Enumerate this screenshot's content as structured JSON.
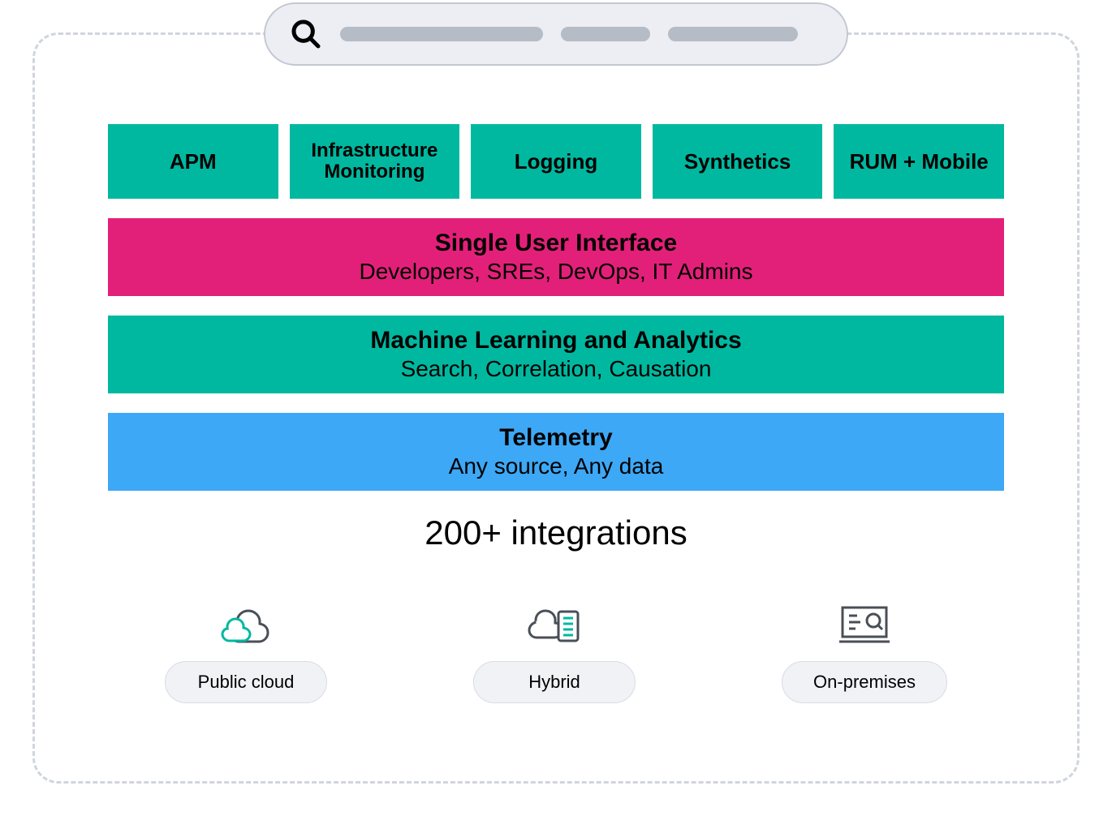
{
  "colors": {
    "teal": "#00b8a0",
    "pink": "#e32079",
    "blue": "#3da8f5",
    "pill_bg": "#eceef4",
    "pill_fill": "#b5bcc6",
    "dash_border": "#d0d5dd"
  },
  "search": {
    "icon": "search-icon"
  },
  "tiles": [
    {
      "label": "APM"
    },
    {
      "label": "Infrastructure Monitoring"
    },
    {
      "label": "Logging"
    },
    {
      "label": "Synthetics"
    },
    {
      "label": "RUM + Mobile"
    }
  ],
  "bands": [
    {
      "title": "Single User Interface",
      "subtitle": "Developers, SREs, DevOps, IT Admins",
      "color": "pink"
    },
    {
      "title": "Machine Learning and Analytics",
      "subtitle": "Search, Correlation, Causation",
      "color": "teal"
    },
    {
      "title": "Telemetry",
      "subtitle": "Any source, Any data",
      "color": "blue"
    }
  ],
  "integrations_text": "200+ integrations",
  "deployments": [
    {
      "label": "Public cloud",
      "icon": "cloud-icon"
    },
    {
      "label": "Hybrid",
      "icon": "hybrid-icon"
    },
    {
      "label": "On-premises",
      "icon": "onprem-icon"
    }
  ]
}
